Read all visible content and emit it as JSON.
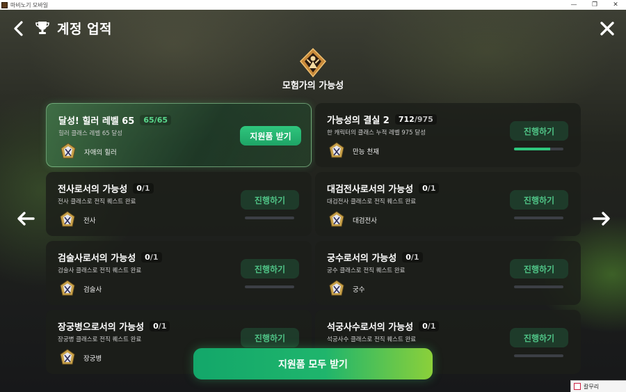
{
  "window": {
    "title": "마비노기 모바일",
    "minimize_icon": "minimize-icon",
    "maximize_icon": "restore-icon",
    "close_icon": "close-icon"
  },
  "header": {
    "title": "계정 업적",
    "back_icon": "chevron-left-icon",
    "trophy_icon": "trophy-icon",
    "close_icon": "x-icon"
  },
  "category": {
    "title": "모험가의 가능성",
    "emblem_icon": "adventurer-emblem-icon"
  },
  "navigation": {
    "prev_icon": "arrow-left-icon",
    "next_icon": "arrow-right-icon"
  },
  "achievements": [
    {
      "title": "달성! 힐러 레벨 65",
      "current": "65",
      "total": "65",
      "description": "힐러 클래스 레벨 65 달성",
      "reward_label": "자애의 힐러",
      "button_label": "지원품 받기",
      "state": "claimable"
    },
    {
      "title": "가능성의 결실 2",
      "current": "712",
      "total": "975",
      "description": "한 캐릭터의 클래스 누적 레벨 975 달성",
      "reward_label": "만능 천재",
      "button_label": "진행하기",
      "state": "in-progress",
      "progress": 0.73
    },
    {
      "title": "전사로서의 가능성",
      "current": "0",
      "total": "1",
      "description": "전사 클래스로 전직 퀘스트 완료",
      "reward_label": "전사",
      "button_label": "진행하기",
      "state": "in-progress",
      "progress": 0
    },
    {
      "title": "대검전사로서의 가능성",
      "current": "0",
      "total": "1",
      "description": "대검전사 클래스로 전직 퀘스트 완료",
      "reward_label": "대검전사",
      "button_label": "진행하기",
      "state": "in-progress",
      "progress": 0
    },
    {
      "title": "검술사로서의 가능성",
      "current": "0",
      "total": "1",
      "description": "검술사 클래스로 전직 퀘스트 완료",
      "reward_label": "검술사",
      "button_label": "진행하기",
      "state": "in-progress",
      "progress": 0
    },
    {
      "title": "궁수로서의 가능성",
      "current": "0",
      "total": "1",
      "description": "궁수 클래스로 전직 퀘스트 완료",
      "reward_label": "궁수",
      "button_label": "진행하기",
      "state": "in-progress",
      "progress": 0
    },
    {
      "title": "장궁병으로서의 가능성",
      "current": "0",
      "total": "1",
      "description": "장궁병 클래스로 전직 퀘스트 완료",
      "reward_label": "장궁병",
      "button_label": "진행하기",
      "state": "in-progress",
      "progress": 0
    },
    {
      "title": "석궁사수로서의 가능성",
      "current": "0",
      "total": "1",
      "description": "석궁사수 클래스로 전직 퀘스트 완료",
      "reward_label": "",
      "button_label": "진행하기",
      "state": "in-progress",
      "progress": 0
    }
  ],
  "footer": {
    "claim_all_label": "지원품 모두 받기"
  },
  "taskbar": {
    "tip_label": "칼무리"
  },
  "colors": {
    "accent_green": "#2fc67d",
    "progress_green_text": "#59d88c",
    "button_dark_green": "#1e3b2a"
  }
}
